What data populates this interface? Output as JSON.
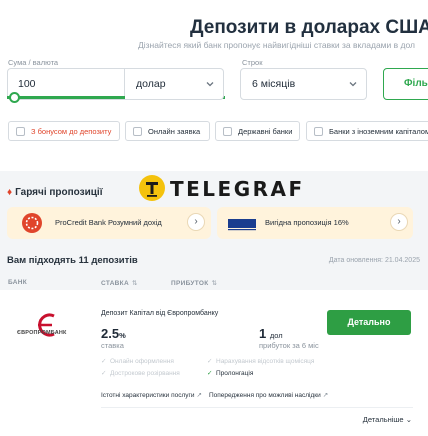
{
  "header": {
    "title": "Депозити в доларах США",
    "subtitle": "Дізнайтеся який банк пропонує найвигідніші ставки за вкладами в дол"
  },
  "filters": {
    "amount_label": "Сума / валюта",
    "amount_value": "100",
    "currency_value": "долар",
    "term_label": "Строк",
    "term_value": "6 місяців",
    "filter_button": "Філь",
    "chips": [
      {
        "label": "З бонусом до депозиту",
        "checked": false
      },
      {
        "label": "Онлайн заявка",
        "checked": false
      },
      {
        "label": "Державні банки",
        "checked": false
      },
      {
        "label": "Банки з іноземним капіталом",
        "checked": false
      }
    ]
  },
  "watermark": {
    "text": "TELEGRAF"
  },
  "hot": {
    "heading": "Гарячі пропозиції",
    "promos": [
      {
        "text": "ProCredit Bank Розумний дохід",
        "arrow": "›"
      },
      {
        "text": "Вигідна пропозиція 16%",
        "arrow": "›",
        "logo_text": "TAS"
      }
    ]
  },
  "results": {
    "count_heading": "Вам підходять 11 депозитів",
    "updated": "Дата оновлення: 21.04.2025",
    "columns": {
      "bank": "БАНК",
      "rate": "СТАВКА",
      "profit": "ПРИБУТОК"
    }
  },
  "card": {
    "bank_logo_text": "ЄВРОПРОМБАНК",
    "name": "Депозит Капітал від Європромбанку",
    "rate_value": "2.5",
    "rate_unit": "%",
    "rate_label": "ставка",
    "profit_value": "1",
    "profit_unit": "дол",
    "profit_label": "прибуток за 6 міс",
    "details_button": "Детально",
    "features": [
      {
        "label": "Онлайн оформлення",
        "available": false
      },
      {
        "label": "Дострокове розірвання",
        "available": false
      },
      {
        "label": "Нарахування відсотків щомісяця",
        "available": false
      },
      {
        "label": "Пролонгація",
        "available": true
      }
    ],
    "links": [
      {
        "label": "Істотні характеристики послуги"
      },
      {
        "label": "Попередження про можливі наслідки"
      }
    ],
    "more": "Детальніше"
  },
  "colors": {
    "accent_green": "#2e9e44",
    "chip_red": "#e0452b",
    "promo_bg": "#fff3dc"
  }
}
